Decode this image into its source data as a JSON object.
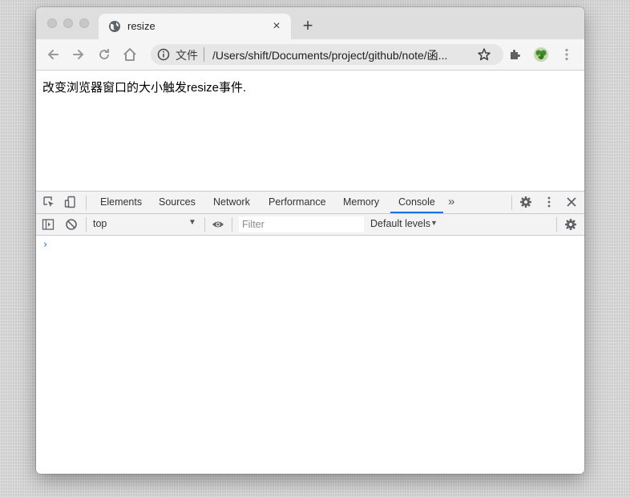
{
  "browser": {
    "tab": {
      "title": "resize",
      "favicon": "globe-icon",
      "close": "×"
    },
    "new_tab": "+",
    "omnibox": {
      "scheme_label": "文件",
      "url": "/Users/shift/Documents/project/github/note/函..."
    }
  },
  "page": {
    "text": "改变浏览器窗口的大小触发resize事件."
  },
  "devtools": {
    "tabs": [
      "Elements",
      "Sources",
      "Network",
      "Performance",
      "Memory",
      "Console"
    ],
    "active_tab": "Console",
    "more": "»",
    "console": {
      "context": "top",
      "filter_placeholder": "Filter",
      "levels": "Default levels",
      "prompt": "›"
    },
    "accent_color": "#1a73e8"
  }
}
